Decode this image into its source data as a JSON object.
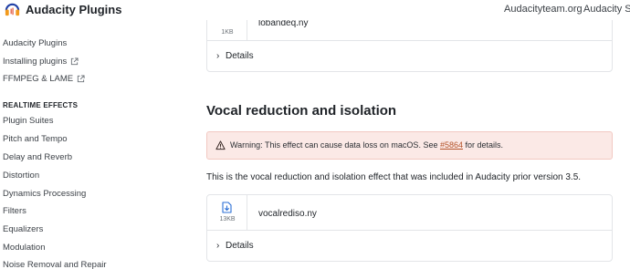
{
  "header": {
    "brand": "Audacity Plugins",
    "links": [
      "Audacityteam.org",
      "Audacity Su"
    ]
  },
  "sidebar": {
    "top_items": [
      {
        "label": "Audacity Plugins",
        "external": false
      },
      {
        "label": "Installing plugins",
        "external": true
      },
      {
        "label": "FFMPEG & LAME",
        "external": true
      }
    ],
    "section_heading": "REALTIME EFFECTS",
    "items": [
      "Plugin Suites",
      "Pitch and Tempo",
      "Delay and Reverb",
      "Distortion",
      "Dynamics Processing",
      "Filters",
      "Equalizers",
      "Modulation",
      "Noise Removal and Repair"
    ]
  },
  "main": {
    "prev_card": {
      "size": "1KB",
      "filename": "lobandeq.ny",
      "details_label": "Details"
    },
    "section_title": "Vocal reduction and isolation",
    "warning": {
      "prefix": "Warning: This effect can cause data loss on macOS. See ",
      "link": "#5864",
      "suffix": " for details."
    },
    "description": "This is the vocal reduction and isolation effect that was included in Audacity prior version 3.5.",
    "card": {
      "size": "13KB",
      "filename": "vocalrediso.ny",
      "details_label": "Details"
    }
  },
  "icons": {
    "logo": "audacity-headphones-logo",
    "external": "external-link-icon",
    "file": "file-download-icon",
    "warning": "warning-triangle-icon",
    "chevron": "chevron-right-icon"
  },
  "colors": {
    "warning_bg": "#fbe9e6",
    "link": "#b4532a",
    "file_icon": "#2b6fd6"
  }
}
